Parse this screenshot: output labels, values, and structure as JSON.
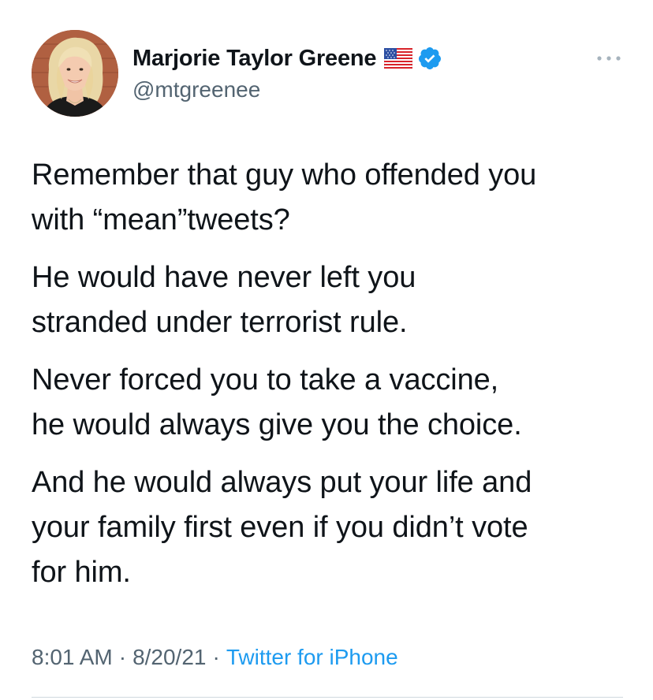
{
  "tweet": {
    "author": {
      "display_name": "Marjorie Taylor Greene",
      "handle": "@mtgreenee",
      "flag_icon": "us-flag-icon",
      "verified_icon": "verified-badge-icon",
      "avatar_icon": "avatar"
    },
    "more_icon": "more-options-icon",
    "paragraphs": [
      "Remember that guy who offended you\nwith “mean”tweets?",
      "He would have never left you\nstranded under terrorist rule.",
      "Never forced you to take a vaccine,\nhe would always give you the choice.",
      "And he would always put your life and\nyour family first even if you didn’t vote\nfor him."
    ],
    "time": "8:01 AM",
    "separator": "·",
    "date": "8/20/21",
    "source": "Twitter for iPhone"
  },
  "colors": {
    "text": "#0f1419",
    "secondary": "#536471",
    "link": "#1d9bf0",
    "verified": "#1d9bf0",
    "divider": "#cfd9de"
  }
}
